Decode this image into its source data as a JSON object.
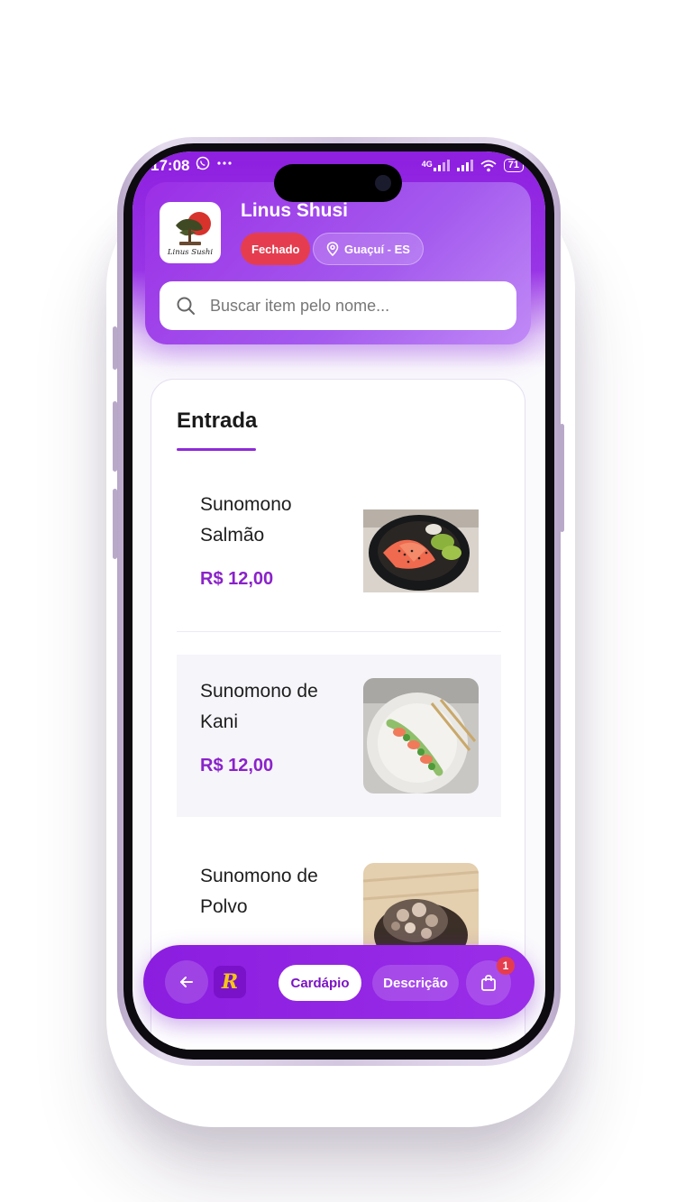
{
  "status_bar": {
    "time": "17:08",
    "left_icons": [
      "whatsapp-icon",
      "more-dots-icon"
    ],
    "network_label": "4G",
    "battery": "71"
  },
  "store": {
    "name": "Linus Shusi",
    "logo_text": "Linus Sushi",
    "status_badge": "Fechado",
    "location": "Guaçuí - ES",
    "status_color": "#e53d4f"
  },
  "search": {
    "placeholder": "Buscar item pelo nome...",
    "value": ""
  },
  "section": {
    "title": "Entrada"
  },
  "menu_items": [
    {
      "name": "Sunomono Salmão",
      "price": "R$ 12,00",
      "image": "salmon-sunomono-photo"
    },
    {
      "name": "Sunomono de Kani",
      "price": "R$ 12,00",
      "image": "kani-sunomono-photo"
    },
    {
      "name": "Sunomono de Polvo",
      "price": "",
      "image": "octopus-sunomono-photo"
    }
  ],
  "bottom_nav": {
    "back_icon": "arrow-left-icon",
    "brand_logo": "R",
    "tabs": [
      {
        "label": "Cardápio",
        "active": true
      },
      {
        "label": "Descrição",
        "active": false
      }
    ],
    "cart_icon": "shopping-bag-icon",
    "cart_count": "1"
  },
  "colors": {
    "brand_purple": "#8e1fe0",
    "price_purple": "#8a22c9",
    "closed_red": "#e53d4f"
  }
}
